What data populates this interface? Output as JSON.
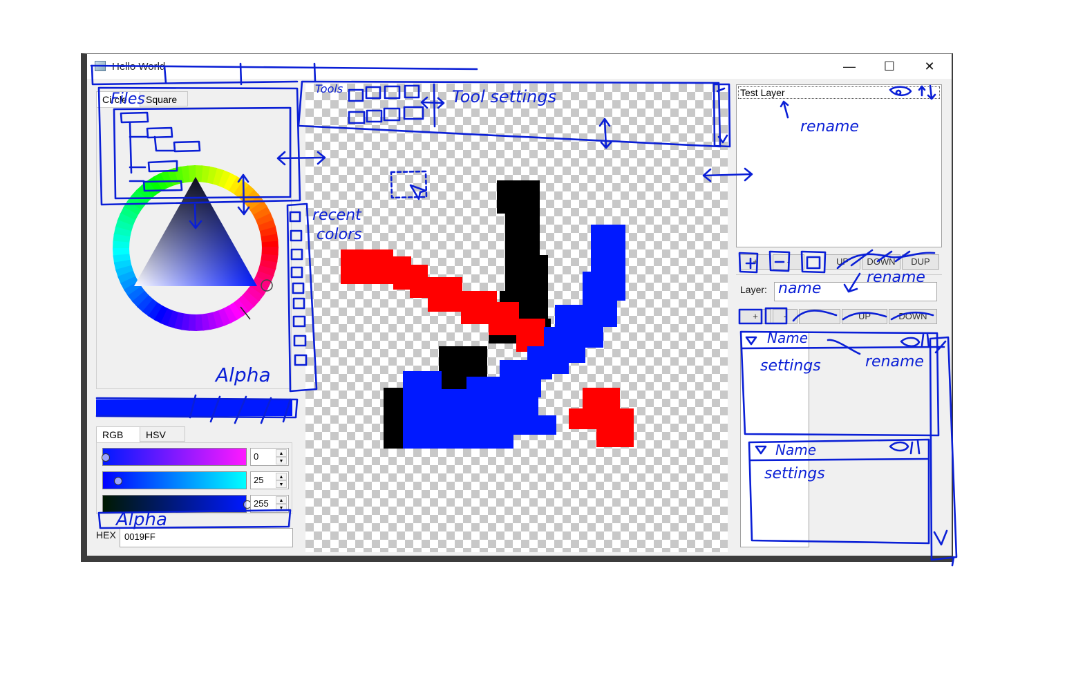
{
  "window": {
    "title": "Hello World",
    "minimize_glyph": "—",
    "maximize_glyph": "☐",
    "close_glyph": "✕"
  },
  "color_picker": {
    "tabs": [
      "Circle",
      "Square"
    ],
    "current_color": "#0019FF",
    "mode_tabs": [
      "RGB",
      "HSV"
    ],
    "channels": [
      {
        "value": "0",
        "gradient": [
          "#0019ff",
          "#ff19ff"
        ]
      },
      {
        "value": "25",
        "gradient": [
          "#0000ff",
          "#00ffff"
        ]
      },
      {
        "value": "255",
        "gradient": [
          "#001900",
          "#0019ff"
        ]
      }
    ],
    "hex_label": "HEX",
    "hex_value": "0019FF"
  },
  "layers": {
    "list": [
      {
        "name": "Test Layer"
      }
    ],
    "buttons": [
      "+",
      "-",
      "UP",
      "DOWN",
      "DUP"
    ],
    "layer_label": "Layer:",
    "layer_name_value": "",
    "effect_buttons": [
      "+",
      "-",
      "",
      "UP",
      "DOWN"
    ]
  },
  "annotations": {
    "files": "Files",
    "tools": "Tools",
    "tool_settings": "Tool settings",
    "recent_colors": [
      "recent",
      "colors"
    ],
    "alpha_top": "Alpha",
    "alpha_bottom": "Alpha",
    "rename_1": "rename",
    "name_field": "name",
    "rename_2": "rename",
    "name_1": "Name",
    "settings_1": "settings",
    "rename_3": "rename",
    "name_2": "Name",
    "settings_2": "settings"
  },
  "colors": {
    "ink": "#0a1fd6",
    "paint_red": "#ff0000",
    "paint_blue": "#0019ff",
    "paint_black": "#000000"
  }
}
